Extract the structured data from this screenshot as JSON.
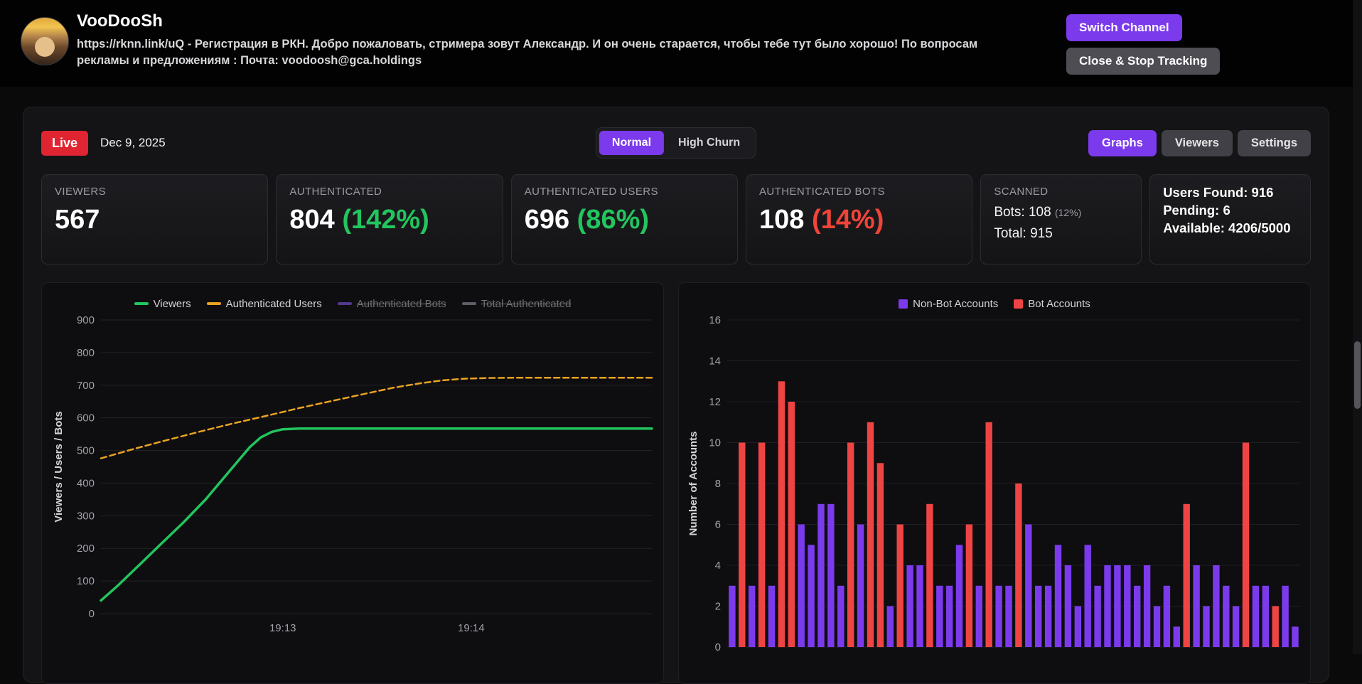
{
  "header": {
    "channel_name": "VooDooSh",
    "description": "https://rknn.link/uQ - Регистрация в РКН. Добро пожаловать, стримера зовут Александр. И он очень старается, чтобы тебе тут было хорошо! По вопросам рекламы и предложениям : Почта: voodoosh@gca.holdings",
    "switch_channel_label": "Switch Channel",
    "close_stop_label": "Close & Stop Tracking",
    "accent_color": "#7c3aed"
  },
  "toolbar": {
    "live_label": "Live",
    "live_color": "#e02431",
    "date": "Dec 9, 2025",
    "mode_normal": "Normal",
    "mode_high_churn": "High Churn",
    "graphs_label": "Graphs",
    "viewers_label": "Viewers",
    "settings_label": "Settings"
  },
  "stats": {
    "viewers": {
      "label": "VIEWERS",
      "value": "567"
    },
    "authenticated": {
      "label": "AUTHENTICATED",
      "value": "804",
      "percent": "(142%)",
      "percent_color": "#22c55e"
    },
    "auth_users": {
      "label": "AUTHENTICATED USERS",
      "value": "696",
      "percent": "(86%)",
      "percent_color": "#22c55e"
    },
    "auth_bots": {
      "label": "AUTHENTICATED BOTS",
      "value": "108",
      "percent": "(14%)",
      "percent_color": "#f04438"
    },
    "scanned": {
      "label": "SCANNED",
      "bots_line": "Bots: 108",
      "bots_percent": "(12%)",
      "total_line": "Total: 915"
    },
    "summary": {
      "users_found": "Users Found: 916",
      "pending": "Pending: 6",
      "available": "Available: 4206/5000"
    }
  },
  "chart_data": [
    {
      "type": "line",
      "title": "",
      "ylabel": "Viewers / Users / Bots",
      "ylim": [
        0,
        900
      ],
      "ytick": 100,
      "grid": true,
      "legend_position": "top",
      "x_ticks": [
        {
          "label": "19:13",
          "pos": 0.33
        },
        {
          "label": "19:14",
          "pos": 0.672
        }
      ],
      "legend": [
        {
          "label": "Viewers",
          "color": "#22c55e",
          "disabled": false
        },
        {
          "label": "Authenticated Users",
          "color": "#eaa221",
          "disabled": false
        },
        {
          "label": "Authenticated Bots",
          "color": "#8b5cf6",
          "disabled": true
        },
        {
          "label": "Total Authenticated",
          "color": "#9ca3af",
          "disabled": true
        }
      ],
      "series": [
        {
          "name": "Viewers",
          "color": "#22c55e",
          "width": 3.5,
          "dash": "",
          "points": [
            [
              0,
              40
            ],
            [
              0.03,
              85
            ],
            [
              0.07,
              150
            ],
            [
              0.11,
              215
            ],
            [
              0.15,
              280
            ],
            [
              0.19,
              350
            ],
            [
              0.22,
              410
            ],
            [
              0.25,
              470
            ],
            [
              0.27,
              510
            ],
            [
              0.29,
              540
            ],
            [
              0.31,
              557
            ],
            [
              0.33,
              565
            ],
            [
              0.36,
              567
            ],
            [
              1,
              567
            ]
          ]
        },
        {
          "name": "Authenticated Users",
          "color": "#eaa221",
          "width": 2.5,
          "dash": "8,5",
          "points": [
            [
              0,
              476
            ],
            [
              0.06,
              505
            ],
            [
              0.12,
              532
            ],
            [
              0.18,
              558
            ],
            [
              0.24,
              583
            ],
            [
              0.3,
              606
            ],
            [
              0.36,
              630
            ],
            [
              0.42,
              652
            ],
            [
              0.48,
              674
            ],
            [
              0.53,
              692
            ],
            [
              0.58,
              706
            ],
            [
              0.62,
              715
            ],
            [
              0.66,
              720
            ],
            [
              0.7,
              722
            ],
            [
              0.75,
              723
            ],
            [
              1,
              723
            ]
          ]
        }
      ]
    },
    {
      "type": "bar",
      "title": "",
      "ylabel": "Number of Accounts",
      "ylim": [
        0,
        16
      ],
      "ytick": 2,
      "grid": true,
      "legend_position": "top",
      "colors": {
        "nonbot": "#7c3aed",
        "bot": "#ef4444"
      },
      "legend": [
        {
          "label": "Non-Bot Accounts",
          "color": "#7c3aed"
        },
        {
          "label": "Bot Accounts",
          "color": "#ef4444"
        }
      ],
      "bars": [
        [
          3,
          "n"
        ],
        [
          10,
          "b"
        ],
        [
          3,
          "n"
        ],
        [
          10,
          "b"
        ],
        [
          3,
          "n"
        ],
        [
          13,
          "b"
        ],
        [
          12,
          "b"
        ],
        [
          6,
          "n"
        ],
        [
          5,
          "n"
        ],
        [
          7,
          "n"
        ],
        [
          7,
          "n"
        ],
        [
          3,
          "n"
        ],
        [
          10,
          "b"
        ],
        [
          6,
          "n"
        ],
        [
          11,
          "b"
        ],
        [
          9,
          "b"
        ],
        [
          2,
          "n"
        ],
        [
          6,
          "b"
        ],
        [
          4,
          "n"
        ],
        [
          4,
          "n"
        ],
        [
          7,
          "b"
        ],
        [
          3,
          "n"
        ],
        [
          3,
          "n"
        ],
        [
          5,
          "n"
        ],
        [
          6,
          "b"
        ],
        [
          3,
          "n"
        ],
        [
          11,
          "b"
        ],
        [
          3,
          "n"
        ],
        [
          3,
          "n"
        ],
        [
          8,
          "b"
        ],
        [
          6,
          "n"
        ],
        [
          3,
          "n"
        ],
        [
          3,
          "n"
        ],
        [
          5,
          "n"
        ],
        [
          4,
          "n"
        ],
        [
          2,
          "n"
        ],
        [
          5,
          "n"
        ],
        [
          3,
          "n"
        ],
        [
          4,
          "n"
        ],
        [
          4,
          "n"
        ],
        [
          4,
          "n"
        ],
        [
          3,
          "n"
        ],
        [
          4,
          "n"
        ],
        [
          2,
          "n"
        ],
        [
          3,
          "n"
        ],
        [
          1,
          "n"
        ],
        [
          7,
          "b"
        ],
        [
          4,
          "n"
        ],
        [
          2,
          "n"
        ],
        [
          4,
          "n"
        ],
        [
          3,
          "n"
        ],
        [
          2,
          "n"
        ],
        [
          10,
          "b"
        ],
        [
          3,
          "n"
        ],
        [
          3,
          "n"
        ],
        [
          2,
          "b"
        ],
        [
          3,
          "n"
        ],
        [
          1,
          "n"
        ]
      ]
    }
  ]
}
